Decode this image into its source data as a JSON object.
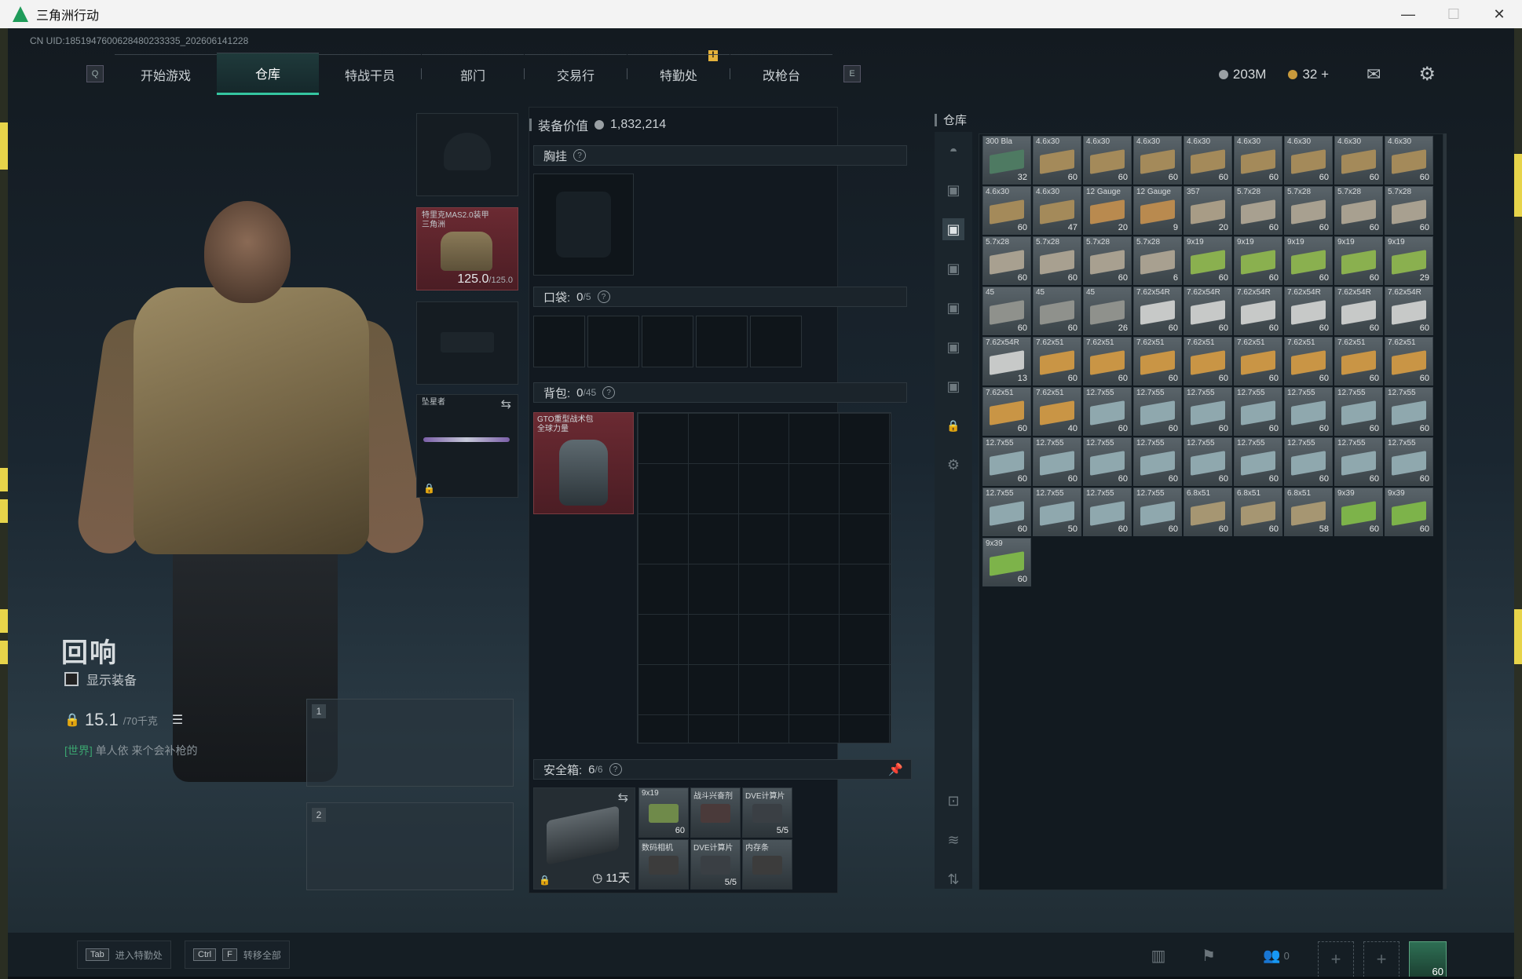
{
  "window": {
    "title": "三角洲行动",
    "min": "—",
    "max": "☐",
    "close": "✕"
  },
  "uid": "CN UID:1851947600628480233335_202606141228",
  "nav": {
    "q_key": "Q",
    "e_key": "E",
    "tabs": [
      {
        "label": "开始游戏",
        "active": false
      },
      {
        "label": "仓库",
        "active": true
      },
      {
        "label": "特战干员",
        "active": false
      },
      {
        "label": "部门",
        "active": false
      },
      {
        "label": "交易行",
        "active": false
      },
      {
        "label": "特勤处",
        "active": false
      },
      {
        "label": "改枪台",
        "active": false
      }
    ],
    "warning": "!"
  },
  "currency": {
    "silver": "203M",
    "gold": "32",
    "plus": "+"
  },
  "character": {
    "name": "回响",
    "show_equipment": "显示装备",
    "weight": "15.1",
    "weight_max": "/70千克",
    "chat_channel": "[世界]",
    "chat_text": "单人依 来个会补枪的"
  },
  "equipment": {
    "armor_name": "特里克MAS2.0装甲",
    "armor_sub": "三角洲",
    "armor_value": "125.0",
    "armor_max": "/125.0",
    "melee_label": "坠星者",
    "slot1": "1",
    "slot2": "2"
  },
  "loadout": {
    "value_label": "装备价值",
    "value": "1,832,214",
    "chest_label": "胸挂",
    "pocket_label": "口袋:",
    "pocket_count": "0",
    "pocket_max": "/5",
    "backpack_label": "背包:",
    "backpack_count": "0",
    "backpack_max": "/45",
    "backpack_name": "GTO重型战术包",
    "backpack_sub": "全球力量",
    "safe_label": "安全箱:",
    "safe_count": "6",
    "safe_max": "/6",
    "safe_timer": "11天",
    "safe_items": [
      {
        "name": "9x19",
        "count": "60"
      },
      {
        "name": "战斗兴奋剂",
        "count": ""
      },
      {
        "name": "DVE计算片",
        "count": "5/5"
      },
      {
        "name": "数码相机",
        "count": ""
      },
      {
        "name": "DVE计算片",
        "count": "5/5"
      },
      {
        "name": "内存条",
        "count": ""
      }
    ]
  },
  "inventory": {
    "title": "仓库",
    "items": [
      {
        "name": "300 Bla",
        "count": "32",
        "color": "#4e7a62"
      },
      {
        "name": "4.6x30",
        "count": "60",
        "color": "#a48a5a"
      },
      {
        "name": "4.6x30",
        "count": "60",
        "color": "#a48a5a"
      },
      {
        "name": "4.6x30",
        "count": "60",
        "color": "#a48a5a"
      },
      {
        "name": "4.6x30",
        "count": "60",
        "color": "#a48a5a"
      },
      {
        "name": "4.6x30",
        "count": "60",
        "color": "#a48a5a"
      },
      {
        "name": "4.6x30",
        "count": "60",
        "color": "#a48a5a"
      },
      {
        "name": "4.6x30",
        "count": "60",
        "color": "#a48a5a"
      },
      {
        "name": "4.6x30",
        "count": "60",
        "color": "#a48a5a"
      },
      {
        "name": "4.6x30",
        "count": "60",
        "color": "#a48a5a"
      },
      {
        "name": "4.6x30",
        "count": "47",
        "color": "#a48a5a"
      },
      {
        "name": "12 Gauge",
        "count": "20",
        "color": "#b98a4f"
      },
      {
        "name": "12 Gauge",
        "count": "9",
        "color": "#b98a4f"
      },
      {
        "name": "357",
        "count": "20",
        "color": "#a89c86"
      },
      {
        "name": "5.7x28",
        "count": "60",
        "color": "#a8a090"
      },
      {
        "name": "5.7x28",
        "count": "60",
        "color": "#a8a090"
      },
      {
        "name": "5.7x28",
        "count": "60",
        "color": "#a8a090"
      },
      {
        "name": "5.7x28",
        "count": "60",
        "color": "#a8a090"
      },
      {
        "name": "5.7x28",
        "count": "60",
        "color": "#a8a090"
      },
      {
        "name": "5.7x28",
        "count": "60",
        "color": "#a8a090"
      },
      {
        "name": "5.7x28",
        "count": "60",
        "color": "#a8a090"
      },
      {
        "name": "5.7x28",
        "count": "6",
        "color": "#a8a090"
      },
      {
        "name": "9x19",
        "count": "60",
        "color": "#8ab04f"
      },
      {
        "name": "9x19",
        "count": "60",
        "color": "#8ab04f"
      },
      {
        "name": "9x19",
        "count": "60",
        "color": "#8ab04f"
      },
      {
        "name": "9x19",
        "count": "60",
        "color": "#8ab04f"
      },
      {
        "name": "9x19",
        "count": "29",
        "color": "#8ab04f"
      },
      {
        "name": "45",
        "count": "60",
        "color": "#8f918c"
      },
      {
        "name": "45",
        "count": "60",
        "color": "#8f918c"
      },
      {
        "name": "45",
        "count": "26",
        "color": "#8f918c"
      },
      {
        "name": "7.62x54R",
        "count": "60",
        "color": "#c7c9c8"
      },
      {
        "name": "7.62x54R",
        "count": "60",
        "color": "#c7c9c8"
      },
      {
        "name": "7.62x54R",
        "count": "60",
        "color": "#c7c9c8"
      },
      {
        "name": "7.62x54R",
        "count": "60",
        "color": "#c7c9c8"
      },
      {
        "name": "7.62x54R",
        "count": "60",
        "color": "#c7c9c8"
      },
      {
        "name": "7.62x54R",
        "count": "60",
        "color": "#c7c9c8"
      },
      {
        "name": "7.62x54R",
        "count": "13",
        "color": "#c7c9c8"
      },
      {
        "name": "7.62x51",
        "count": "60",
        "color": "#c99545"
      },
      {
        "name": "7.62x51",
        "count": "60",
        "color": "#c99545"
      },
      {
        "name": "7.62x51",
        "count": "60",
        "color": "#c99545"
      },
      {
        "name": "7.62x51",
        "count": "60",
        "color": "#c99545"
      },
      {
        "name": "7.62x51",
        "count": "60",
        "color": "#c99545"
      },
      {
        "name": "7.62x51",
        "count": "60",
        "color": "#c99545"
      },
      {
        "name": "7.62x51",
        "count": "60",
        "color": "#c99545"
      },
      {
        "name": "7.62x51",
        "count": "60",
        "color": "#c99545"
      },
      {
        "name": "7.62x51",
        "count": "60",
        "color": "#c99545"
      },
      {
        "name": "7.62x51",
        "count": "40",
        "color": "#c99545"
      },
      {
        "name": "12.7x55",
        "count": "60",
        "color": "#8fa8ae"
      },
      {
        "name": "12.7x55",
        "count": "60",
        "color": "#8fa8ae"
      },
      {
        "name": "12.7x55",
        "count": "60",
        "color": "#8fa8ae"
      },
      {
        "name": "12.7x55",
        "count": "60",
        "color": "#8fa8ae"
      },
      {
        "name": "12.7x55",
        "count": "60",
        "color": "#8fa8ae"
      },
      {
        "name": "12.7x55",
        "count": "60",
        "color": "#8fa8ae"
      },
      {
        "name": "12.7x55",
        "count": "60",
        "color": "#8fa8ae"
      },
      {
        "name": "12.7x55",
        "count": "60",
        "color": "#8fa8ae"
      },
      {
        "name": "12.7x55",
        "count": "60",
        "color": "#8fa8ae"
      },
      {
        "name": "12.7x55",
        "count": "60",
        "color": "#8fa8ae"
      },
      {
        "name": "12.7x55",
        "count": "60",
        "color": "#8fa8ae"
      },
      {
        "name": "12.7x55",
        "count": "60",
        "color": "#8fa8ae"
      },
      {
        "name": "12.7x55",
        "count": "60",
        "color": "#8fa8ae"
      },
      {
        "name": "12.7x55",
        "count": "60",
        "color": "#8fa8ae"
      },
      {
        "name": "12.7x55",
        "count": "60",
        "color": "#8fa8ae"
      },
      {
        "name": "12.7x55",
        "count": "60",
        "color": "#8fa8ae"
      },
      {
        "name": "12.7x55",
        "count": "60",
        "color": "#8fa8ae"
      },
      {
        "name": "12.7x55",
        "count": "50",
        "color": "#8fa8ae"
      },
      {
        "name": "12.7x55",
        "count": "60",
        "color": "#8fa8ae"
      },
      {
        "name": "12.7x55",
        "count": "60",
        "color": "#8fa8ae"
      },
      {
        "name": "6.8x51",
        "count": "60",
        "color": "#a69672"
      },
      {
        "name": "6.8x51",
        "count": "60",
        "color": "#a69672"
      },
      {
        "name": "6.8x51",
        "count": "58",
        "color": "#a69672"
      },
      {
        "name": "9x39",
        "count": "60",
        "color": "#7db34a"
      },
      {
        "name": "9x39",
        "count": "60",
        "color": "#7db34a"
      },
      {
        "name": "9x39",
        "count": "60",
        "color": "#7db34a"
      }
    ]
  },
  "bottom": {
    "hint1_key": "Tab",
    "hint1_text": "进入特勤处",
    "hint2_key1": "Ctrl",
    "hint2_key2": "F",
    "hint2_text": "转移全部",
    "friends": "0",
    "avatar_level": "60"
  }
}
